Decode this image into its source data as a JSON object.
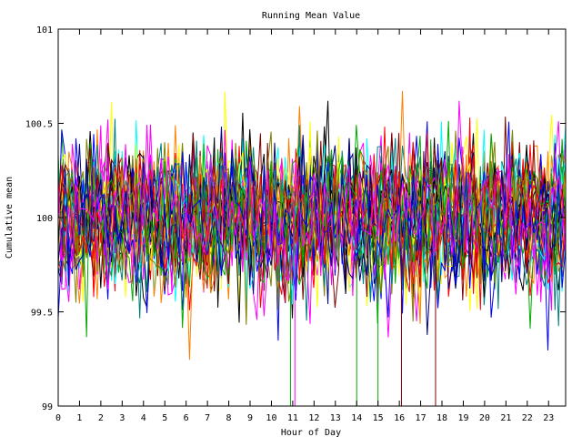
{
  "chart_data": {
    "type": "line",
    "title": "Running Mean Value",
    "xlabel": "Hour of Day",
    "ylabel": "Cumulative mean",
    "xlim": [
      0,
      23.8
    ],
    "ylim": [
      99,
      101
    ],
    "x_ticks": [
      "0",
      "1",
      "2",
      "3",
      "4",
      "5",
      "6",
      "7",
      "8",
      "9",
      "10",
      "11",
      "12",
      "13",
      "14",
      "15",
      "16",
      "17",
      "18",
      "19",
      "20",
      "21",
      "22",
      "23"
    ],
    "y_ticks": [
      "99",
      "99.5",
      "100",
      "100.5",
      "101"
    ],
    "grid": false,
    "legend": "none",
    "series_colors": [
      "#ff0000",
      "#00aa00",
      "#0000ff",
      "#ff00ff",
      "#00ffff",
      "#ffff00",
      "#000000",
      "#ff8000",
      "#800000",
      "#008080",
      "#000080",
      "#808000"
    ],
    "series_count": 40,
    "points_per_series": 144,
    "value_center": 100,
    "value_spread": 0.25,
    "notable_spikes": [
      {
        "x": 10.9,
        "y": 99
      },
      {
        "x": 11.1,
        "y": 99
      },
      {
        "x": 14.0,
        "y": 99
      },
      {
        "x": 15.0,
        "y": 99
      },
      {
        "x": 16.1,
        "y": 99
      },
      {
        "x": 17.7,
        "y": 99
      }
    ]
  }
}
